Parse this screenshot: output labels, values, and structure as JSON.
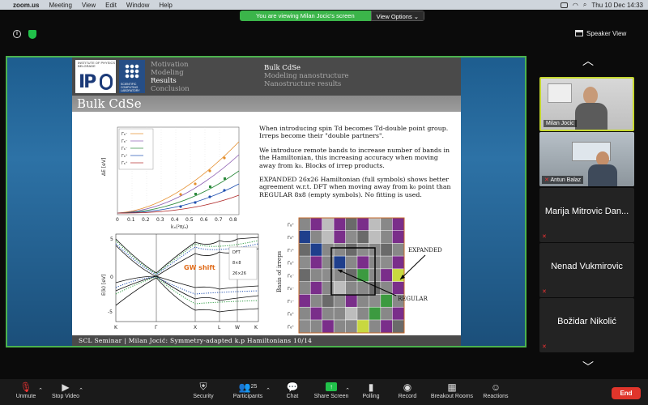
{
  "menubar": {
    "app": "zoom.us",
    "items": [
      "Meeting",
      "View",
      "Edit",
      "Window",
      "Help"
    ],
    "clock": "Thu 10 Dec  14:33"
  },
  "banner": {
    "message": "You are viewing Milan Jocic's screen",
    "view_options": "View Options ⌄"
  },
  "top": {
    "speaker_view": "Speaker View"
  },
  "slide": {
    "logo_text": "IP",
    "logo_small": "INSTITUTE OF PHYSICS BELGRADE",
    "scl_text": "SCIENTIFIC COMPUTING LABORATORY",
    "nav_left": [
      "Motivation",
      "Modeling",
      "Results",
      "Conclusion"
    ],
    "nav_left_current": "Results",
    "nav_right": [
      "Bulk CdSe",
      "Modeling nanostructure",
      "Nanostructure results"
    ],
    "title": "Bulk CdSe",
    "paragraphs": [
      "When introducing spin Td becomes Td-double point group. Irreps become their \"double partners\".",
      "We introduce remote bands to increase number of bands in the Hamiltonian, this increasing accuracy when moving away from k₀. Blocks of irrep products.",
      "EXPANDED 26x26 Hamiltonian (full symbols) shows better agreement w.r.t. DFT when moving away from k₀ point than REGULAR 8x8 (empty symbols). No fitting is used."
    ],
    "plot1": {
      "ylabel": "ΔE [eV]",
      "xlabel": "kₓ(²π/ₐ)",
      "xticks": [
        "0",
        "0.1",
        "0.2",
        "0.3",
        "0.4",
        "0.5",
        "0.6",
        "0.7",
        "0.8"
      ],
      "legend": [
        "Γ₈⁻",
        "Γ₈⁻",
        "Γ₆⁻",
        "Γ₈⁺",
        "Γ₆⁺"
      ]
    },
    "plot2": {
      "ylabel": "E(k) [eV]",
      "yticks": [
        "5",
        "0",
        "-5"
      ],
      "xticks": [
        "K",
        "Γ",
        "X",
        "L",
        "W",
        "K"
      ],
      "annotation": "GW shift",
      "legend": [
        "DFT",
        "8×8",
        "26×26"
      ]
    },
    "heatmap": {
      "ylabel": "Basis of irreps",
      "expanded_label": "EXPANDED",
      "regular_label": "REGULAR",
      "grid": [
        [
          "#888",
          "#7a2e8a",
          "#bdbdbd",
          "#7a2e8a",
          "#6a6a6a",
          "#7a2e8a",
          "#bdbdbd",
          "#888",
          "#7a2e8a"
        ],
        [
          "#1f3f8c",
          "#888",
          "#bdbdbd",
          "#7a2e8a",
          "#8c8c8c",
          "#6a6a6a",
          "#bdbdbd",
          "#888",
          "#7a2e8a"
        ],
        [
          "#6a6a6a",
          "#1f3f8c",
          "#888",
          "#888",
          "#6a6a6a",
          "#8c8c8c",
          "#888",
          "#6a6a6a",
          "#888"
        ],
        [
          "#8c8c8c",
          "#7a2e8a",
          "#888",
          "#1f3f8c",
          "#888",
          "#7a2e8a",
          "#888",
          "#8c8c8c",
          "#7a2e8a"
        ],
        [
          "#6a6a6a",
          "#888",
          "#8c8c8c",
          "#888",
          "#6a6a6a",
          "#3c9a40",
          "#888",
          "#7a2e8a",
          "#c8d840"
        ],
        [
          "#888",
          "#7a2e8a",
          "#888",
          "#bdbdbd",
          "#888",
          "#888",
          "#6a6a6a",
          "#888",
          "#7a2e8a"
        ],
        [
          "#7a2e8a",
          "#888",
          "#6a6a6a",
          "#8c8c8c",
          "#7a2e8a",
          "#888",
          "#8c8c8c",
          "#3c9a40",
          "#888"
        ],
        [
          "#888",
          "#7a2e8a",
          "#888",
          "#888",
          "#bdbdbd",
          "#888",
          "#3c9a40",
          "#888",
          "#7a2e8a"
        ],
        [
          "#8c8c8c",
          "#888",
          "#7a2e8a",
          "#888",
          "#888",
          "#c8d840",
          "#888",
          "#7a2e8a",
          "#6a6a6a"
        ]
      ],
      "row_labels": [
        "Γ₈⁺",
        "Γ₈⁺",
        "Γ₇⁺",
        "Γ₈⁺",
        "Γ₆⁻",
        "Γ₈⁻",
        "Γ₇⁻",
        "Γ₈⁺",
        "Γ₆⁺"
      ]
    },
    "footer": "SCL Seminar  |  Milan Jocić: Symmetry-adapted k.p Hamiltonians 10/14"
  },
  "participants": [
    {
      "name": "Milan Jocic",
      "type": "video"
    },
    {
      "name": "Antun Balaz",
      "type": "video"
    },
    {
      "name": "Marija Mitrovic Dan...",
      "type": "name"
    },
    {
      "name": "Nenad Vukmirovic",
      "type": "name"
    },
    {
      "name": "Božidar Nikolić",
      "type": "name"
    }
  ],
  "toolbar": {
    "unmute": "Unmute",
    "stop_video": "Stop Video",
    "security": "Security",
    "participants": "Participants",
    "participants_count": "25",
    "chat": "Chat",
    "share_screen": "Share Screen",
    "polling": "Polling",
    "record": "Record",
    "breakout": "Breakout Rooms",
    "reactions": "Reactions",
    "end": "End"
  },
  "colors": {
    "active_border": "#4cb34e",
    "banner_green": "#3bb54a",
    "end_red": "#e0352b",
    "speaker_highlight": "#c6d830"
  }
}
